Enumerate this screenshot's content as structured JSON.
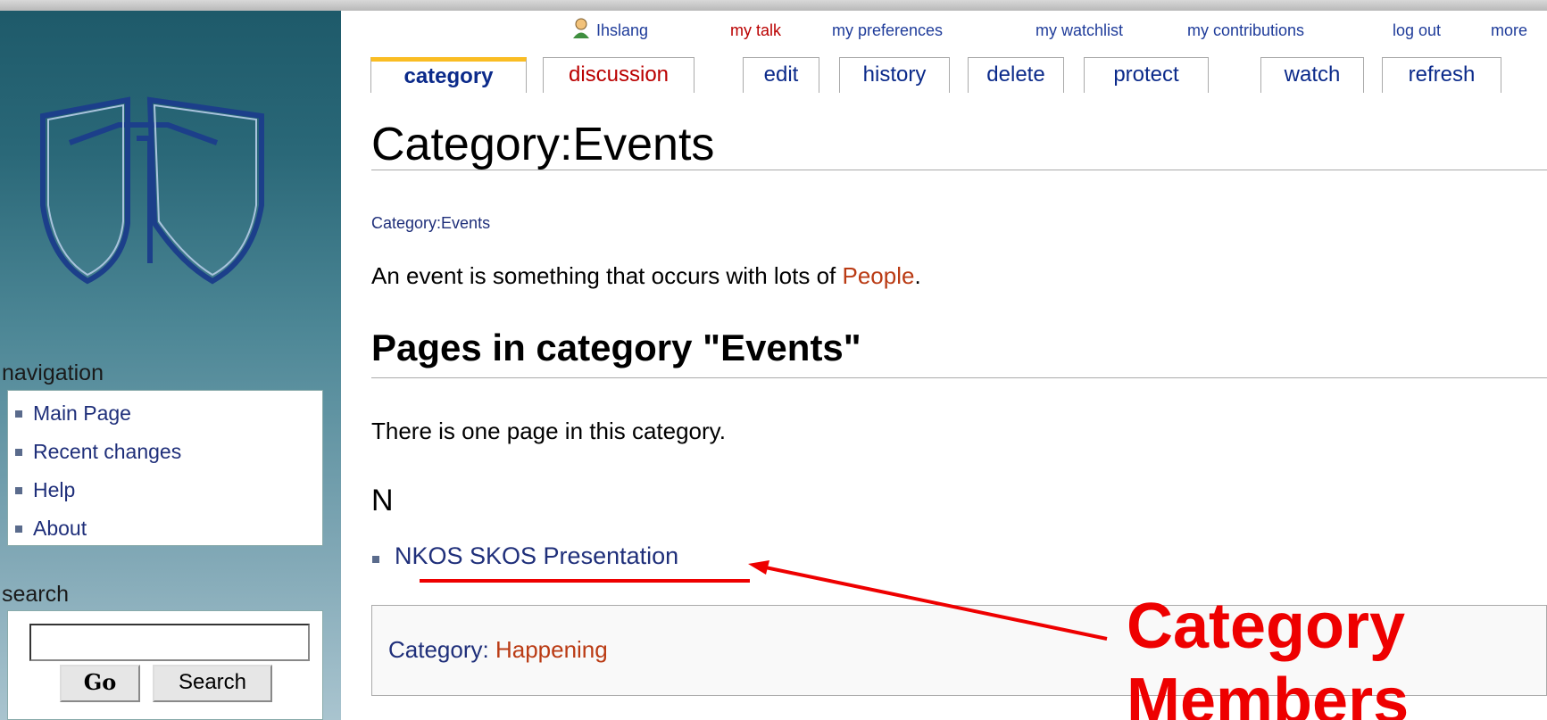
{
  "personal_bar": {
    "user": "Ihslang",
    "talk": "my talk",
    "preferences": "my preferences",
    "watchlist": "my watchlist",
    "contributions": "my contributions",
    "logout": "log out",
    "more": "more"
  },
  "tabs": [
    {
      "label": "category",
      "selected": true
    },
    {
      "label": "discussion",
      "red": true
    },
    {
      "label": "edit"
    },
    {
      "label": "history"
    },
    {
      "label": "delete"
    },
    {
      "label": "protect"
    },
    {
      "label": "watch"
    },
    {
      "label": "refresh"
    }
  ],
  "sidebar": {
    "navigation_title": "navigation",
    "nav_items": [
      "Main Page",
      "Recent changes",
      "Help",
      "About"
    ],
    "search_title": "search",
    "go_label": "Go",
    "search_label": "Search"
  },
  "content": {
    "title": "Category:Events",
    "breadcrumb": "Category:Events",
    "intro_prefix": "An event is something that occurs with lots of ",
    "intro_link": "People",
    "intro_suffix": ".",
    "section_heading": "Pages in category \"Events\"",
    "count_text": "There is one page in this category.",
    "letter": "N",
    "member": "NKOS SKOS Presentation",
    "catlinks_prefix": "Category: ",
    "catlinks_link": "Happening"
  },
  "annotation": {
    "line1": "Category",
    "line2": "Members"
  },
  "colors": {
    "tab_accent": "#fabd23",
    "annotation": "#ee0000",
    "red_link": "#ba3b14"
  }
}
